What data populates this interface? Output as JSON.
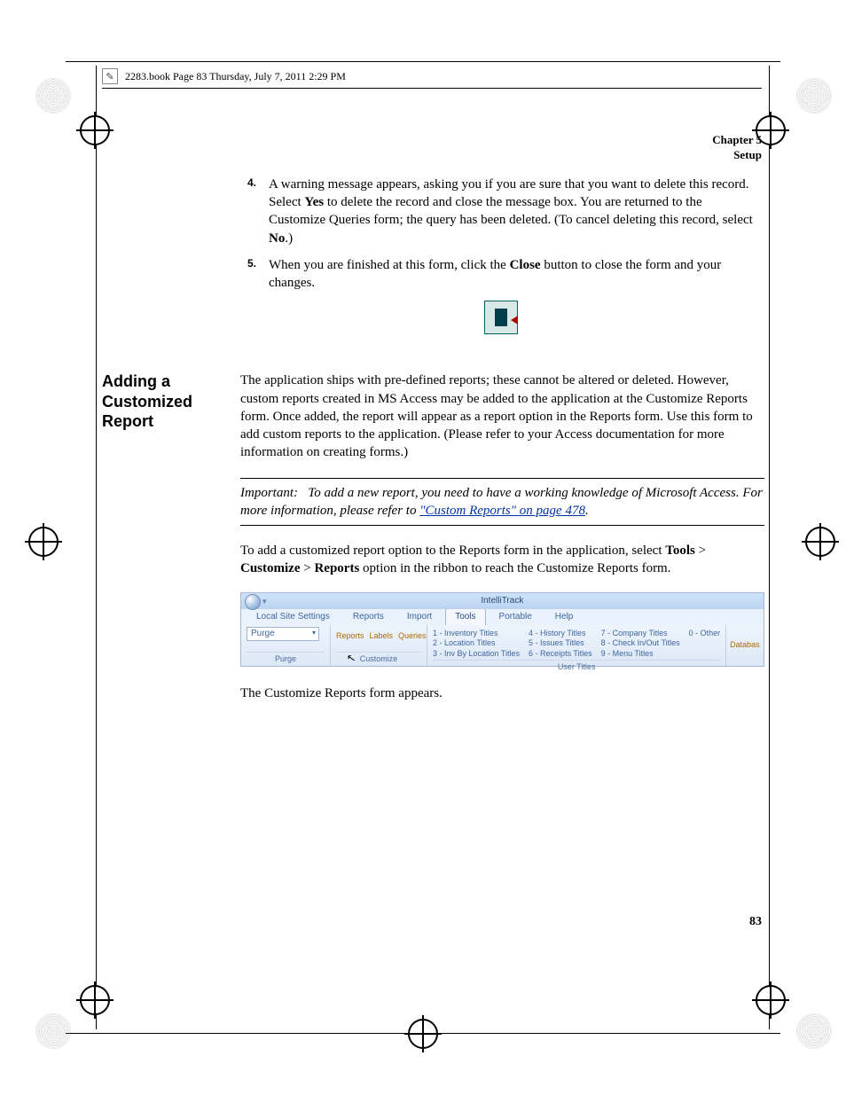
{
  "header": {
    "book_tag": "2283.book  Page 83  Thursday, July 7, 2011  2:29 PM"
  },
  "chapter": {
    "line1": "Chapter 5",
    "line2": "Setup"
  },
  "steps": [
    {
      "num": "4.",
      "text_before": "A warning message appears, asking you if you are sure that you want to delete this record. Select ",
      "bold1": "Yes",
      "text_mid": " to delete the record and close the message box. You are returned to the Customize Queries form; the query has been deleted. (To cancel deleting this record, select ",
      "bold2": "No",
      "text_after": ".)"
    },
    {
      "num": "5.",
      "text_before": "When you are finished at this form, click the ",
      "bold1": "Close",
      "text_mid": " button to close the form and your changes.",
      "bold2": "",
      "text_after": ""
    }
  ],
  "section": {
    "title": "Adding a Customized Report",
    "para": "The application ships with pre-defined reports; these cannot be altered or deleted. However, custom reports created in MS Access may be added to the application at the Customize Reports form. Once added, the report will appear as a report option in the Reports form. Use this form to add custom reports to the application. (Please refer to your Access documentation for more information on creating forms.)"
  },
  "important": {
    "label": "Important:",
    "text1": "To add a new report, you need to have a working knowledge of Microsoft Access. For more information, please refer to ",
    "link": "\"Custom Reports\" on page 478",
    "text2": "."
  },
  "nav_para": {
    "text1": "To add a customized report option to the Reports form in the application, select ",
    "b1": "Tools",
    "sep": " > ",
    "b2": "Customize",
    "b3": "Reports",
    "text2": " option in the ribbon to reach the Customize Reports form."
  },
  "ribbon": {
    "app_title": "IntelliTrack",
    "qat": "▾",
    "tabs": [
      "Local Site Settings",
      "Reports",
      "Import",
      "Tools",
      "Portable",
      "Help"
    ],
    "active_tab_index": 3,
    "purge_label": "Purge",
    "purge_group": "Purge",
    "customize": {
      "reports": "Reports",
      "labels": "Labels",
      "queries": "Queries",
      "group": "Customize"
    },
    "titles": [
      [
        "1 - Inventory Titles",
        "4 - History Titles",
        "7 - Company Titles",
        "0 - Other"
      ],
      [
        "2 - Location Titles",
        "5 - Issues Titles",
        "8 - Check In/Out Titles",
        ""
      ],
      [
        "3 - Inv By Location Titles",
        "6 - Receipts Titles",
        "9 - Menu Titles",
        ""
      ]
    ],
    "user_titles": "User Titles",
    "database": "Databas"
  },
  "after_ribbon": "The Customize Reports form appears.",
  "page_number": "83"
}
